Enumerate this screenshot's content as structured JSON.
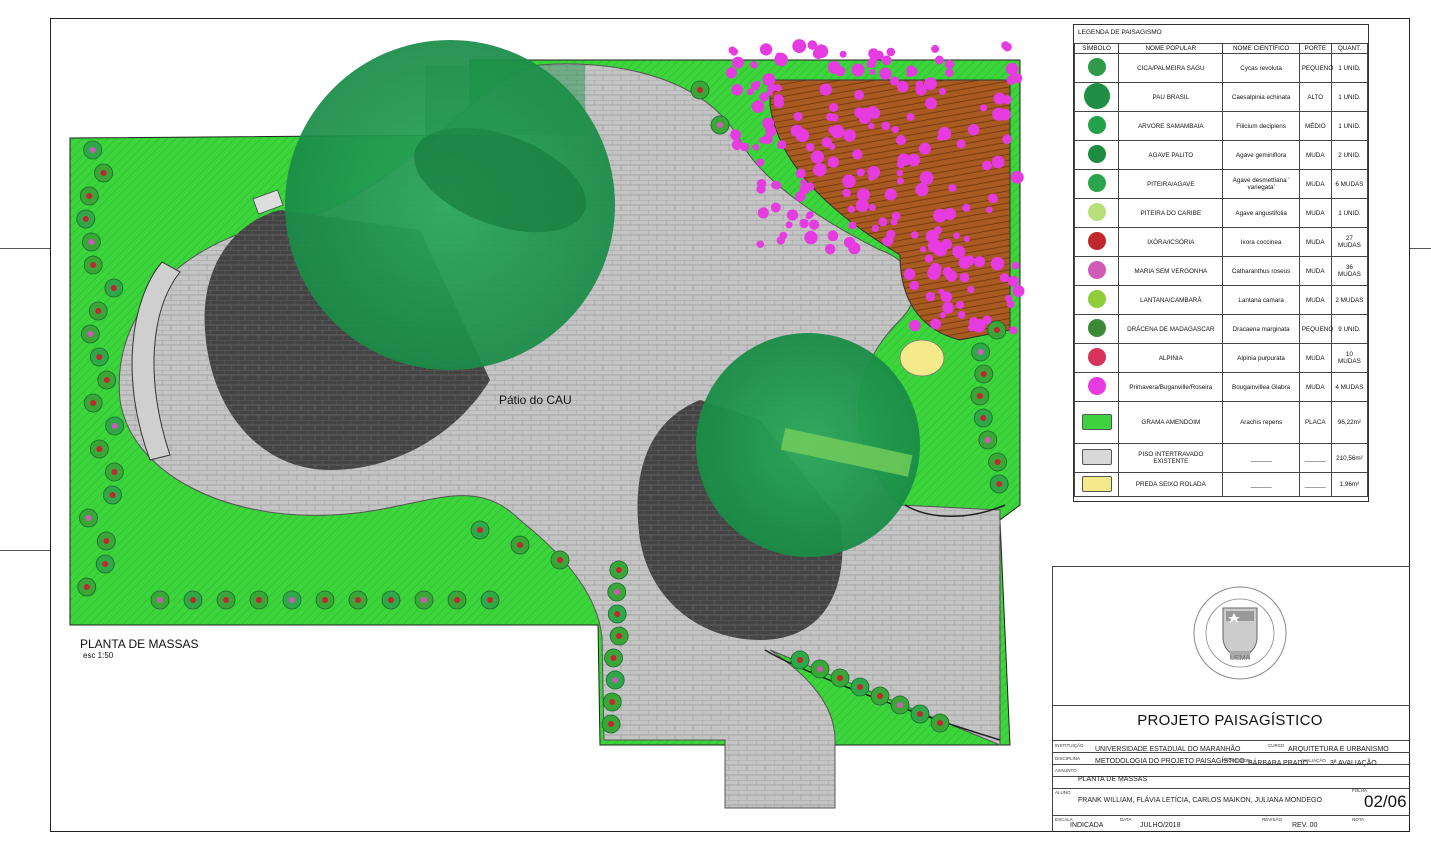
{
  "plan": {
    "title": "PLANTA DE MASSAS",
    "scale": "esc  1:50",
    "patio_label": "Pátio do CAU"
  },
  "legend": {
    "title": "LEGENDA  DE  PAISAGISMO",
    "headers": [
      "SÍMBOLO",
      "NOME POPULAR",
      "NOME CIENTÍFICO",
      "PORTE",
      "QUANT."
    ],
    "rows": [
      {
        "popular": "CICA/PALMEIRA SAGU",
        "scientific": "Cycas revoluta",
        "porte": "PEQUENO",
        "quant": "1  UNID.",
        "symbol": "cycas-symbol",
        "color": "#2e9a4a"
      },
      {
        "popular": "PAU BRASIL",
        "scientific": "Caesalpinia echinata",
        "porte": "ALTO",
        "quant": "1  UNID.",
        "symbol": "pau-brasil-symbol",
        "color": "#1f8f45"
      },
      {
        "popular": "ARVORE SAMAMBAIA",
        "scientific": "Filicium decipiens",
        "porte": "MÉDIO",
        "quant": "1  UNID.",
        "symbol": "samambaia-symbol",
        "color": "#22a24a"
      },
      {
        "popular": "AGAVE PALITO",
        "scientific": "Agave geminiflora",
        "porte": "MUDA",
        "quant": "2  UNID.",
        "symbol": "agave-palito-symbol",
        "color": "#1d8c3f"
      },
      {
        "popular": "PITEIRA/AGAVE",
        "scientific": "Agave desmettiana ' variegata'",
        "porte": "MUDA",
        "quant": "6 MUDAS",
        "symbol": "piteira-symbol",
        "color": "#2aa54c"
      },
      {
        "popular": "PITEIRA DO CARIBE",
        "scientific": "Agave angustifolia",
        "porte": "MUDA",
        "quant": "1  UNID.",
        "symbol": "piteira-caribe-symbol",
        "color": "#b8e07a"
      },
      {
        "popular": "IXÓRA/ICSÓRIA",
        "scientific": "Ixora coccinea",
        "porte": "MUDA",
        "quant": "27 MUDAS",
        "symbol": "ixora-symbol",
        "color": "#c0282e"
      },
      {
        "popular": "MARIA SEM VERGONHA",
        "scientific": "Catharanthus roseus",
        "porte": "MUDA",
        "quant": "36 MUDAS",
        "symbol": "maria-symbol",
        "color": "#d05ab8"
      },
      {
        "popular": "LANTANA/CAMBARÁ",
        "scientific": "Lantana camara",
        "porte": "MUDA",
        "quant": "2 MUDAS",
        "symbol": "lantana-symbol",
        "color": "#8fce3a"
      },
      {
        "popular": "DRÁCENA  DE  MADAGASCAR",
        "scientific": "Dracaena marginata",
        "porte": "PEQUENO",
        "quant": "9  UNID.",
        "symbol": "dracena-symbol",
        "color": "#3a8a38"
      },
      {
        "popular": "ALPINIA",
        "scientific": "Alpinia purpurata",
        "porte": "MUDA",
        "quant": "10 MUDAS",
        "symbol": "alpinia-symbol",
        "color": "#d8335b"
      },
      {
        "popular": "Primavera/Buganville/Roseira",
        "scientific": "Bougainvillea Glabra",
        "porte": "MUDA",
        "quant": "4 MUDAS",
        "symbol": "bougainvillea-symbol",
        "color": "#e63be0"
      },
      {
        "popular": "GRAMA AMENDOIM",
        "scientific": "Arachis repens",
        "porte": "PLACA",
        "quant": "96,22m²",
        "symbol": "grama-symbol",
        "color": "#3ed33e"
      },
      {
        "popular": "PISO  INTERTRAVADO  EXISTENTE",
        "scientific": "______",
        "porte": "______",
        "quant": "210,56m²",
        "symbol": "piso-symbol",
        "color": "#d8d8d8"
      },
      {
        "popular": "PREDA  SEIXO  ROLADA",
        "scientific": "______",
        "porte": "______",
        "quant": "1,96m²",
        "symbol": "seixo-symbol",
        "color": "#f4ea8a"
      }
    ]
  },
  "title_block": {
    "title": "PROJETO PAISAGÍSTICO",
    "instituicao_label": "INSTITUIÇÃO",
    "instituicao": "UNIVERSIDADE ESTADUAL DO MARANHÃO",
    "curso_label": "CURSO",
    "curso": "ARQUITETURA E URBANISMO",
    "disciplina_label": "DISCIPLINA",
    "disciplina": "METODOLOGIA DO PROJETO PAISAGÍSTICO",
    "professor_label": "PROFESSOR",
    "professor": "BÁRBARA PRADO",
    "avaliacao_label": "AVALIAÇÃO",
    "avaliacao": "3ª AVALIAÇÃO",
    "assunto_label": "ASSUNTO",
    "assunto": "PLANTA DE MASSAS",
    "aluno_label": "ALUNO",
    "aluno": "FRANK WILLIAM, FLÁVIA LETÍCIA, CARLOS MAIKON, JULIANA MONDEGO",
    "folha_label": "FOLHA",
    "folha": "02/06",
    "escala_label": "ESCALA",
    "escala": "INDICADA",
    "data_label": "DATA",
    "data": "JULHO/2018",
    "revisao_label": "REVISÃO",
    "revisao": "REV. 00",
    "nota_label": "NOTA",
    "seal_text": "UNIVERSIDADE ESTADUAL DO MARANHÃO",
    "seal_abbr": "UEMA"
  },
  "colors": {
    "grass": "#3bd63b",
    "paving": "#bfbfbf",
    "dark_paving": "#4a4a4a",
    "tree": "#1f9a4f",
    "bougainvillea": "#e63be0",
    "deck": "#a2541a"
  }
}
